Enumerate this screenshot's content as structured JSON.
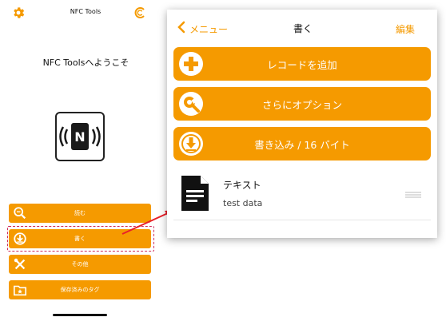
{
  "left_screen": {
    "header": {
      "title": "NFC Tools"
    },
    "welcome": "NFC Toolsへようこそ",
    "menu": [
      {
        "label": "読む",
        "icon": "search-icon"
      },
      {
        "label": "書く",
        "icon": "write-icon"
      },
      {
        "label": "その他",
        "icon": "tools-icon"
      },
      {
        "label": "保存済みのタグ",
        "icon": "folder-star-icon"
      }
    ]
  },
  "popup": {
    "nav": {
      "back": "メニュー",
      "title": "書く",
      "edit": "編集"
    },
    "buttons": [
      {
        "label": "レコードを追加",
        "icon": "plus-circle-icon"
      },
      {
        "label": "さらにオプション",
        "icon": "wrench-circle-icon"
      },
      {
        "label": "書き込み / 16 バイト",
        "icon": "download-circle-icon"
      }
    ],
    "record": {
      "title": "テキスト",
      "subtitle": "test data"
    }
  },
  "colors": {
    "accent": "#f59a00",
    "highlight": "#d02b5a",
    "arrow": "#e8202a"
  }
}
